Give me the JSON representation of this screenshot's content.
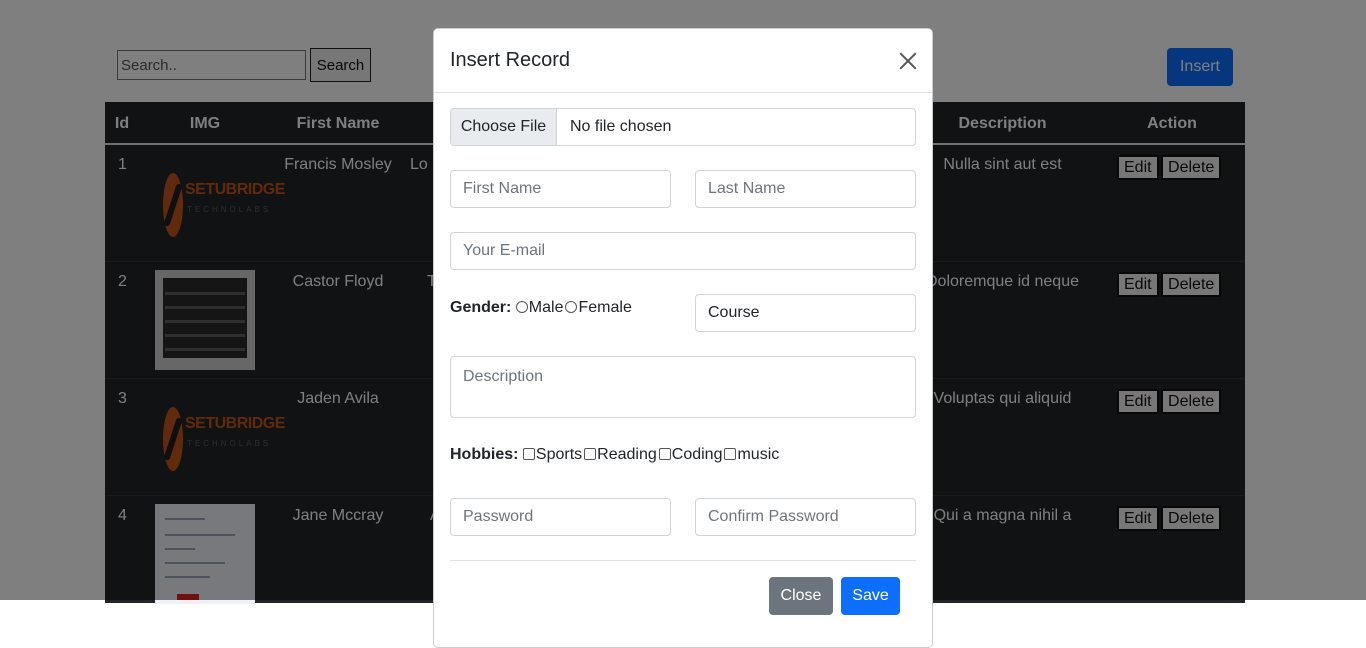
{
  "toolbar": {
    "search_placeholder": "Search..",
    "search_label": "Search",
    "insert_label": "Insert"
  },
  "table": {
    "headers": [
      "Id",
      "IMG",
      "First Name",
      "Description",
      "Action"
    ],
    "rows": [
      {
        "id": "1",
        "first_name": "Francis Mosley",
        "last_name": "Lo",
        "description": "Nulla sint aut est",
        "image": "setubridge-logo"
      },
      {
        "id": "2",
        "first_name": "Castor Floyd",
        "last_name": "T",
        "description": "Doloremque id neque",
        "image": "screenshot-thumbnail"
      },
      {
        "id": "3",
        "first_name": "Jaden Avila",
        "last_name": "",
        "description": "Voluptas qui aliquid",
        "image": "setubridge-logo"
      },
      {
        "id": "4",
        "first_name": "Jane Mccray",
        "last_name": "A",
        "description": "Qui a magna nihil a",
        "image": "form-thumbnail"
      }
    ],
    "edit_label": "Edit",
    "delete_label": "Delete",
    "logo_text": "SETUBRIDGE",
    "logo_subtext": "TECHNOLABS"
  },
  "modal": {
    "title": "Insert Record",
    "file_button": "Choose File",
    "file_status": "No file chosen",
    "first_name_placeholder": "First Name",
    "last_name_placeholder": "Last Name",
    "email_placeholder": "Your E-mail",
    "gender_label": "Gender:",
    "gender_options": [
      "Male",
      "Female"
    ],
    "course_value": "Course",
    "description_placeholder": "Description",
    "hobbies_label": "Hobbies:",
    "hobbies_options": [
      "Sports",
      "Reading",
      "Coding",
      "music"
    ],
    "password_placeholder": "Password",
    "confirm_password_placeholder": "Confirm Password",
    "close_label": "Close",
    "save_label": "Save"
  },
  "colors": {
    "primary": "#0d6efd",
    "secondary": "#6c757d",
    "table_dark": "#212529"
  }
}
